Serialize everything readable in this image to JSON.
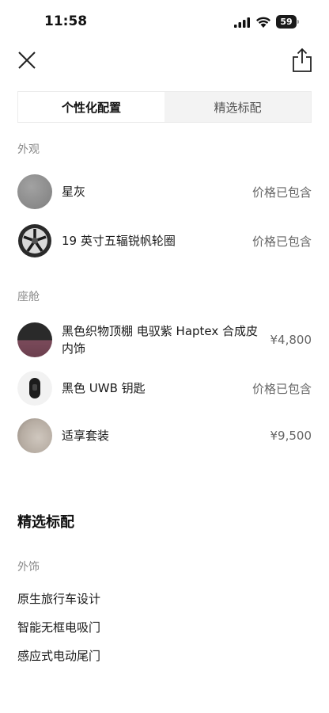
{
  "status_bar": {
    "time": "11:58",
    "battery": "59"
  },
  "tabs": [
    {
      "label": "个性化配置",
      "active": true
    },
    {
      "label": "精选标配",
      "active": false
    }
  ],
  "exterior": {
    "label": "外观",
    "items": [
      {
        "name": "星灰",
        "price": "价格已包含"
      },
      {
        "name": "19 英寸五辐锐帆轮圈",
        "price": "价格已包含"
      }
    ]
  },
  "cabin": {
    "label": "座舱",
    "items": [
      {
        "name": "黑色织物顶棚 电驭紫 Haptex 合成皮内饰",
        "price": "¥4,800"
      },
      {
        "name": "黑色 UWB 钥匙",
        "price": "价格已包含"
      },
      {
        "name": "适享套装",
        "price": "¥9,500"
      }
    ]
  },
  "standard": {
    "heading": "精选标配",
    "section_label": "外饰",
    "features": [
      "原生旅行车设计",
      "智能无框电吸门",
      "感应式电动尾门"
    ]
  },
  "colors": {
    "swatch_grey": "#8a8a8a",
    "interior_purple": "#7a4a5a",
    "text_muted": "#8a8a8a"
  }
}
